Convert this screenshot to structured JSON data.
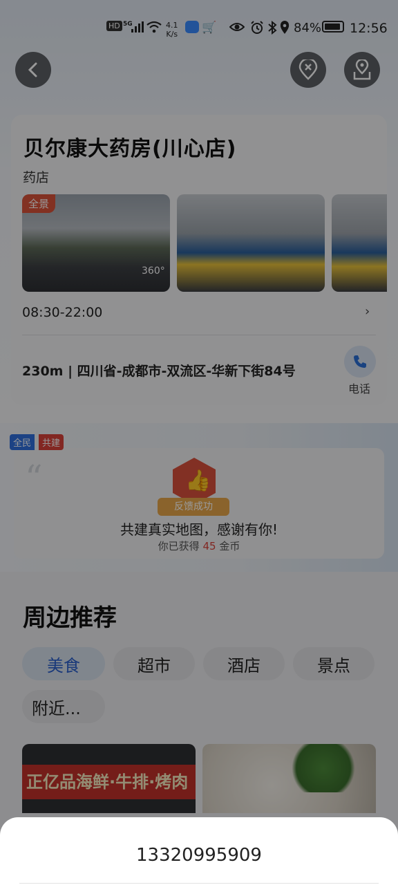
{
  "status_bar": {
    "hd": "HD",
    "network": "5G",
    "speed": "4.1\nK/s",
    "battery": "84%",
    "time": "12:56"
  },
  "poi": {
    "name": "贝尔康大药房(川心店)",
    "type": "药店",
    "pano_tag": "全景",
    "pano_360": "360°",
    "hours": "08:30-22:00",
    "address": "230m | 四川省-成都市-双流区-华新下街84号",
    "call_label": "电话"
  },
  "cobuild": {
    "tag_left": "全民",
    "tag_right": "共建",
    "badge_text": "反馈成功",
    "title": "共建真实地图，感谢有你!",
    "sub_prefix": "你已获得",
    "coins": "45",
    "sub_suffix": "金币"
  },
  "nearby": {
    "title": "周边推荐",
    "tabs": [
      {
        "label": "美食",
        "active": true
      },
      {
        "label": "超市",
        "active": false
      },
      {
        "label": "酒店",
        "active": false
      },
      {
        "label": "景点",
        "active": false
      },
      {
        "label": "附近...",
        "active": false
      }
    ],
    "card1_sign": "正亿品海鲜·牛排·烤肉"
  },
  "sheet": {
    "phone": "13320995909"
  },
  "colors": {
    "accent": "#2b5fcc",
    "coin": "#d9413a",
    "overlay": "rgba(0,0,0,0.40)"
  }
}
